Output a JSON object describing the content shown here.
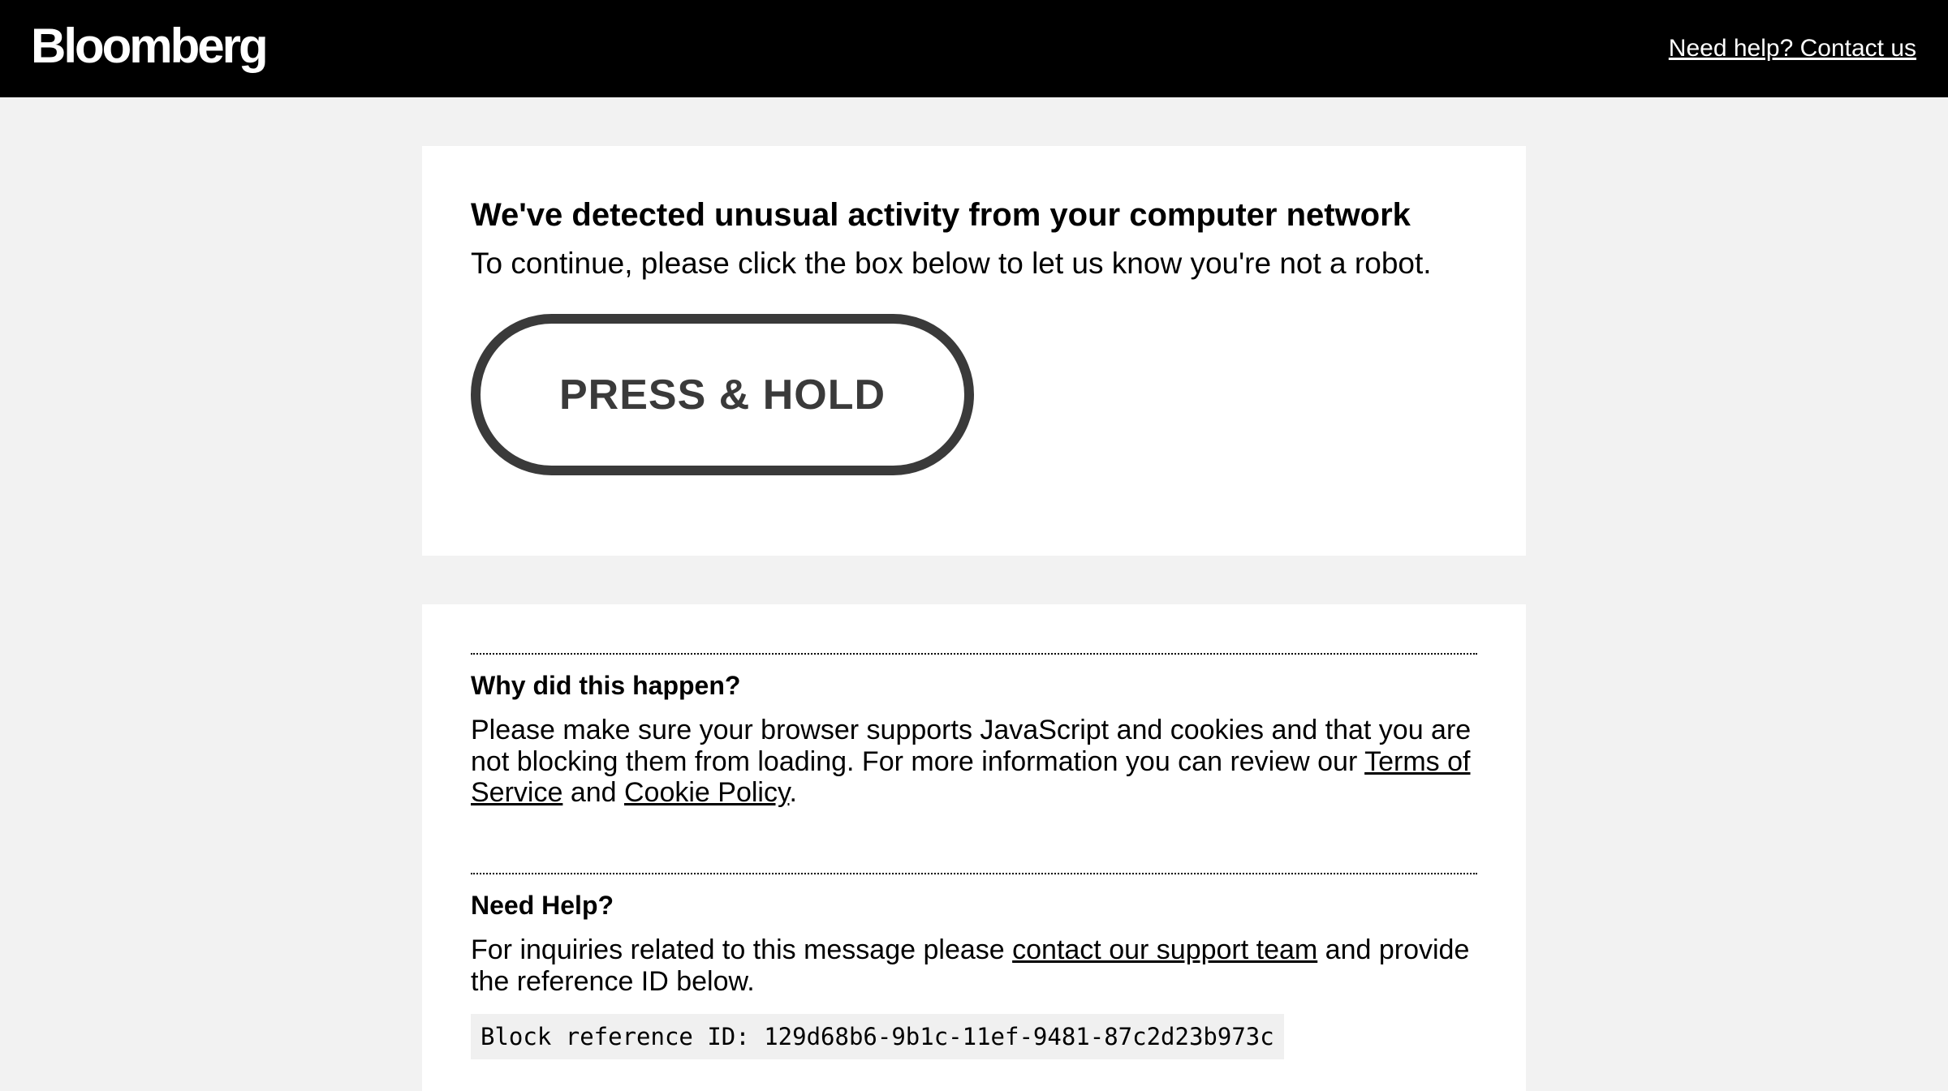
{
  "header": {
    "logo_text": "Bloomberg",
    "help_link_label": "Need help? Contact us",
    "background_color": "#000000"
  },
  "challenge": {
    "heading": "We've detected unusual activity from your computer network",
    "instruction": "To continue, please click the box below to let us know you're not a robot.",
    "button_label": "PRESS & HOLD",
    "button_color": "#3a3a3a"
  },
  "why_section": {
    "title": "Why did this happen?",
    "body_prefix": "Please make sure your browser supports JavaScript and cookies and that you are not blocking them from loading. For more information you can review our ",
    "terms_link": "Terms of Service",
    "middle_text": " and ",
    "cookie_link": "Cookie Policy",
    "body_suffix": "."
  },
  "help_section": {
    "title": "Need Help?",
    "body_prefix": "For inquiries related to this message please ",
    "support_link": "contact our support team",
    "body_suffix": " and provide the reference ID below.",
    "reference_label": "Block reference ID: 129d68b6-9b1c-11ef-9481-87c2d23b973c"
  },
  "colors": {
    "page_background": "#f2f2f2",
    "card_background": "#ffffff"
  }
}
